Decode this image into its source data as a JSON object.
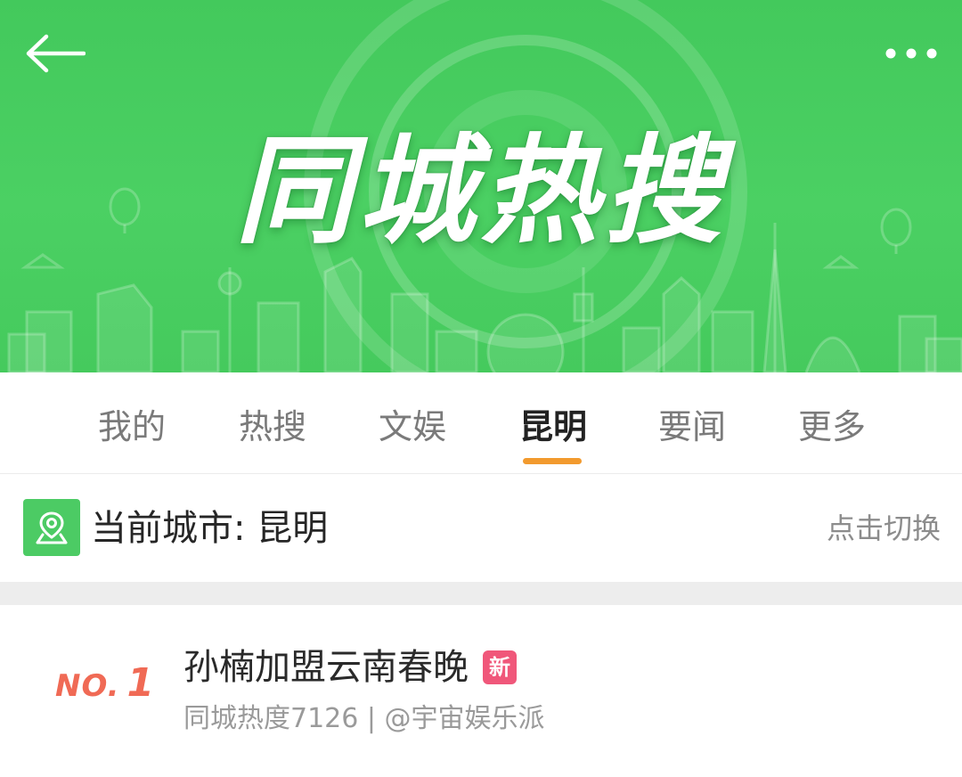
{
  "header": {
    "title": "同城热搜",
    "back_icon": "arrow-left-icon",
    "more_icon": "more-dots-icon",
    "accent_color": "#4bd063"
  },
  "tabs": [
    {
      "label": "我的",
      "active": false
    },
    {
      "label": "热搜",
      "active": false
    },
    {
      "label": "文娱",
      "active": false
    },
    {
      "label": "昆明",
      "active": true
    },
    {
      "label": "要闻",
      "active": false
    },
    {
      "label": "更多",
      "active": false
    }
  ],
  "tab_indicator_color": "#f29a2e",
  "city": {
    "icon": "location-pin-icon",
    "label": "当前城市: 昆明",
    "switch_label": "点击切换"
  },
  "hot_list": [
    {
      "rank_prefix": "NO.",
      "rank": "1",
      "title": "孙楠加盟云南春晚",
      "badge": "新",
      "meta": "同城热度7126 | @宇宙娱乐派",
      "rank_color": "#f06a55",
      "badge_color": "#f0577a"
    }
  ]
}
